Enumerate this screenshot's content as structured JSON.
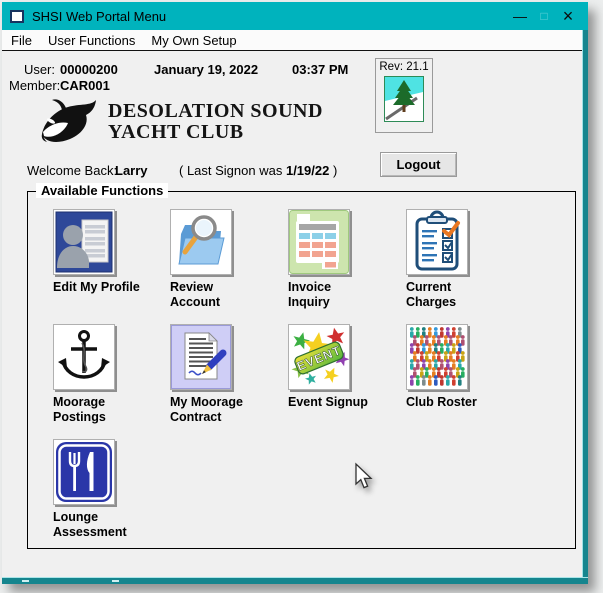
{
  "window": {
    "title": "SHSI Web Portal Menu",
    "minimize_glyph": "—",
    "maximize_glyph": "□",
    "close_glyph": "×"
  },
  "menu": {
    "items": [
      {
        "label": "File"
      },
      {
        "label": "User Functions"
      },
      {
        "label": "My Own Setup"
      }
    ]
  },
  "header": {
    "user_label": "User:",
    "user_value": "00000200",
    "member_label": "Member:",
    "member_value": "CAR001",
    "date": "January 19, 2022",
    "time": "03:37 PM",
    "rev_label": "Rev: 21.1",
    "club_name_line1": "DESOLATION SOUND",
    "club_name_line2": "YACHT CLUB"
  },
  "welcome": {
    "label": "Welcome Back:",
    "name": "Larry",
    "signon_prefix": "( Last Signon was",
    "signon_date": "1/19/22",
    "signon_suffix": ")"
  },
  "logout": {
    "label": "Logout"
  },
  "functions": {
    "group_label": "Available Functions",
    "items": [
      {
        "label": "Edit My Profile",
        "icon": "profile-icon"
      },
      {
        "label": "Review\nAccount",
        "icon": "folder-search-icon"
      },
      {
        "label": "Invoice\nInquiry",
        "icon": "invoice-table-icon"
      },
      {
        "label": "Current\nCharges",
        "icon": "clipboard-check-icon"
      },
      {
        "label": "Moorage\nPostings",
        "icon": "anchor-icon"
      },
      {
        "label": "My Moorage\nContract",
        "icon": "contract-pencil-icon"
      },
      {
        "label": "Event Signup",
        "icon": "event-stars-icon"
      },
      {
        "label": "Club Roster",
        "icon": "crowd-icon"
      },
      {
        "label": "Lounge\nAssessment",
        "icon": "dining-icon"
      }
    ]
  },
  "colors": {
    "titlebar_teal": "#00B3BD",
    "border_teal": "#15858E",
    "content_bg": "#F0F0F0",
    "profile_blue": "#2E4899",
    "dining_blue": "#2A36A8"
  }
}
